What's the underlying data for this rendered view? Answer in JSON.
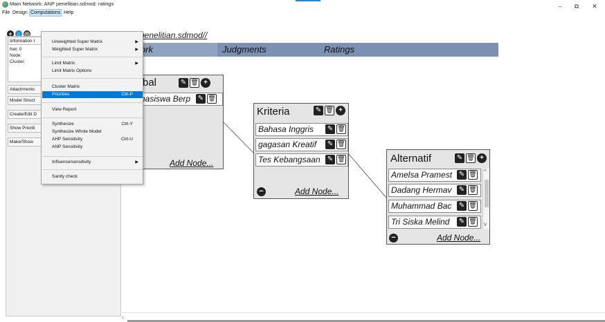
{
  "window": {
    "title": "Main Network: ANP penelitian.sdmod: ratings",
    "controls": {
      "minimize": "–",
      "maximize": "⧉",
      "close": "✕"
    }
  },
  "menubar": {
    "items": [
      "File",
      "Design",
      "Computations",
      "Help"
    ],
    "active": "Computations"
  },
  "toolbar": {
    "icons": [
      "add-icon",
      "circle-icon",
      "cluster-icon"
    ]
  },
  "filepath": "penelitian.sdmod//",
  "tabs": [
    "ork",
    "Judgments",
    "Ratings"
  ],
  "leftpanel": {
    "info_label": "Information I",
    "info_lines": [
      "Net: 0",
      "Node:",
      "Cluster:"
    ],
    "buttons": [
      "Attachments",
      "Model Struct",
      "Create/Edit D",
      "Show Prioriti",
      "Make/Show"
    ]
  },
  "computations_menu": {
    "items": [
      {
        "label": "Unweighted Super Matrix",
        "submenu": true
      },
      {
        "label": "Weighted Super Matrix",
        "submenu": true
      },
      {
        "label": "Limit Matrix",
        "submenu": true
      },
      {
        "label": "Limit Matrix Options"
      },
      {
        "label": "Cluster Matrix"
      },
      {
        "label": "Priorities",
        "shortcut": "Ctrl-P",
        "selected": true
      },
      {
        "label": "View Report"
      },
      {
        "label": "Synthesize",
        "shortcut": "Ctrl-Y"
      },
      {
        "label": "Synthesize Whole Model"
      },
      {
        "label": "AHP Sensitivity",
        "shortcut": "Ctrl-U"
      },
      {
        "label": "ANP Sensitivity"
      },
      {
        "label": "Influence/sensitivity",
        "submenu": true
      },
      {
        "label": "Sanity check"
      }
    ]
  },
  "clusters": {
    "goal": {
      "title": "bal",
      "nodes": [
        "hasiswa Berp"
      ],
      "add_label": "Add Node..."
    },
    "kriteria": {
      "title": "Kriteria",
      "nodes": [
        "Bahasa Inggris",
        "gagasan Kreatif",
        "Tes Kebangsaan"
      ],
      "add_label": "Add Node..."
    },
    "alternatif": {
      "title": "Alternatif",
      "nodes": [
        "Amelsa Pramest",
        "Dadang Hermav",
        "Muhammad Bac",
        "Tri Siska Melind"
      ],
      "add_label": "Add Node..."
    }
  },
  "colors": {
    "tabstrip": "#7b90b3",
    "selected": "#0078d7",
    "cluster_bg": "#e5e5e5"
  }
}
